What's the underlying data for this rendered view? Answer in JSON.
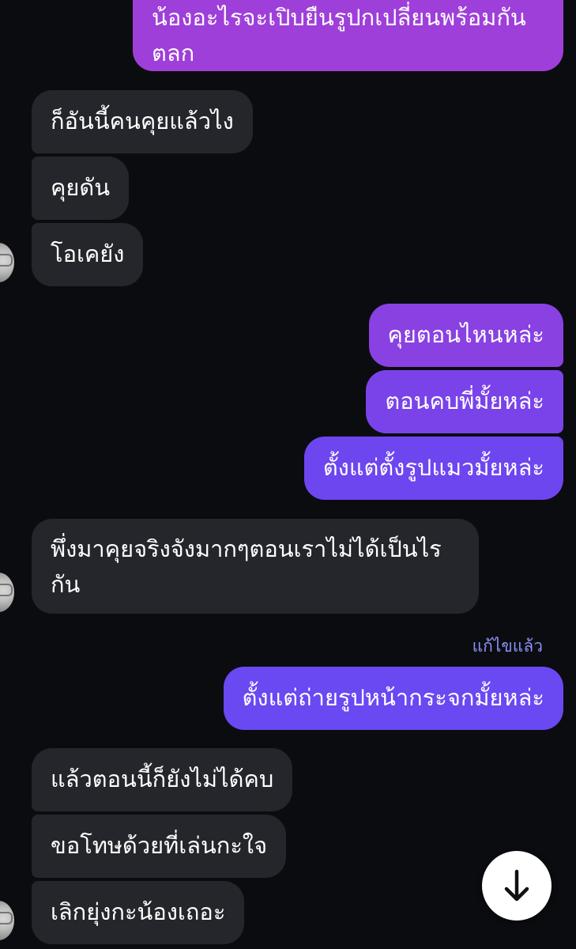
{
  "colors": {
    "background": "#0b0c10",
    "incoming_bubble": "#24262b",
    "outgoing_top": "#9f3fd9",
    "outgoing_mid": "#7b3fe8",
    "outgoing_bottom": "#6a48f2",
    "edited_label": "#8a8ff7"
  },
  "messages": {
    "m0": "น้องอะไรจะเปิบยืนรูปกเปลี่ยนพร้อมกัน\nตลก",
    "m1": "ก็อันนี้คนคุยแล้วไง",
    "m2": "คุยดัน",
    "m3": "โอเคยัง",
    "m4": "คุยตอนไหนหล่ะ",
    "m5": "ตอนคบพี่มั้ยหล่ะ",
    "m6": "ตั้งแต่ตั้งรูปแมวมั้ยหล่ะ",
    "m7": "พึ่งมาคุยจริงจังมากๆตอนเราไม่ได้เป็นไร\nกัน",
    "m8": "ตั้งแต่ถ่ายรูปหน้ากระจกมั้ยหล่ะ",
    "m9": "แล้วตอนนี้ก็ยังไม่ได้คบ",
    "m10": "ขอโทษด้วยที่เล่นกะใจ",
    "m11": "เลิกยุ่งกะน้องเถอะ"
  },
  "edited_label": "แก้ไขแล้ว",
  "scroll_icon": "arrow-down-icon"
}
